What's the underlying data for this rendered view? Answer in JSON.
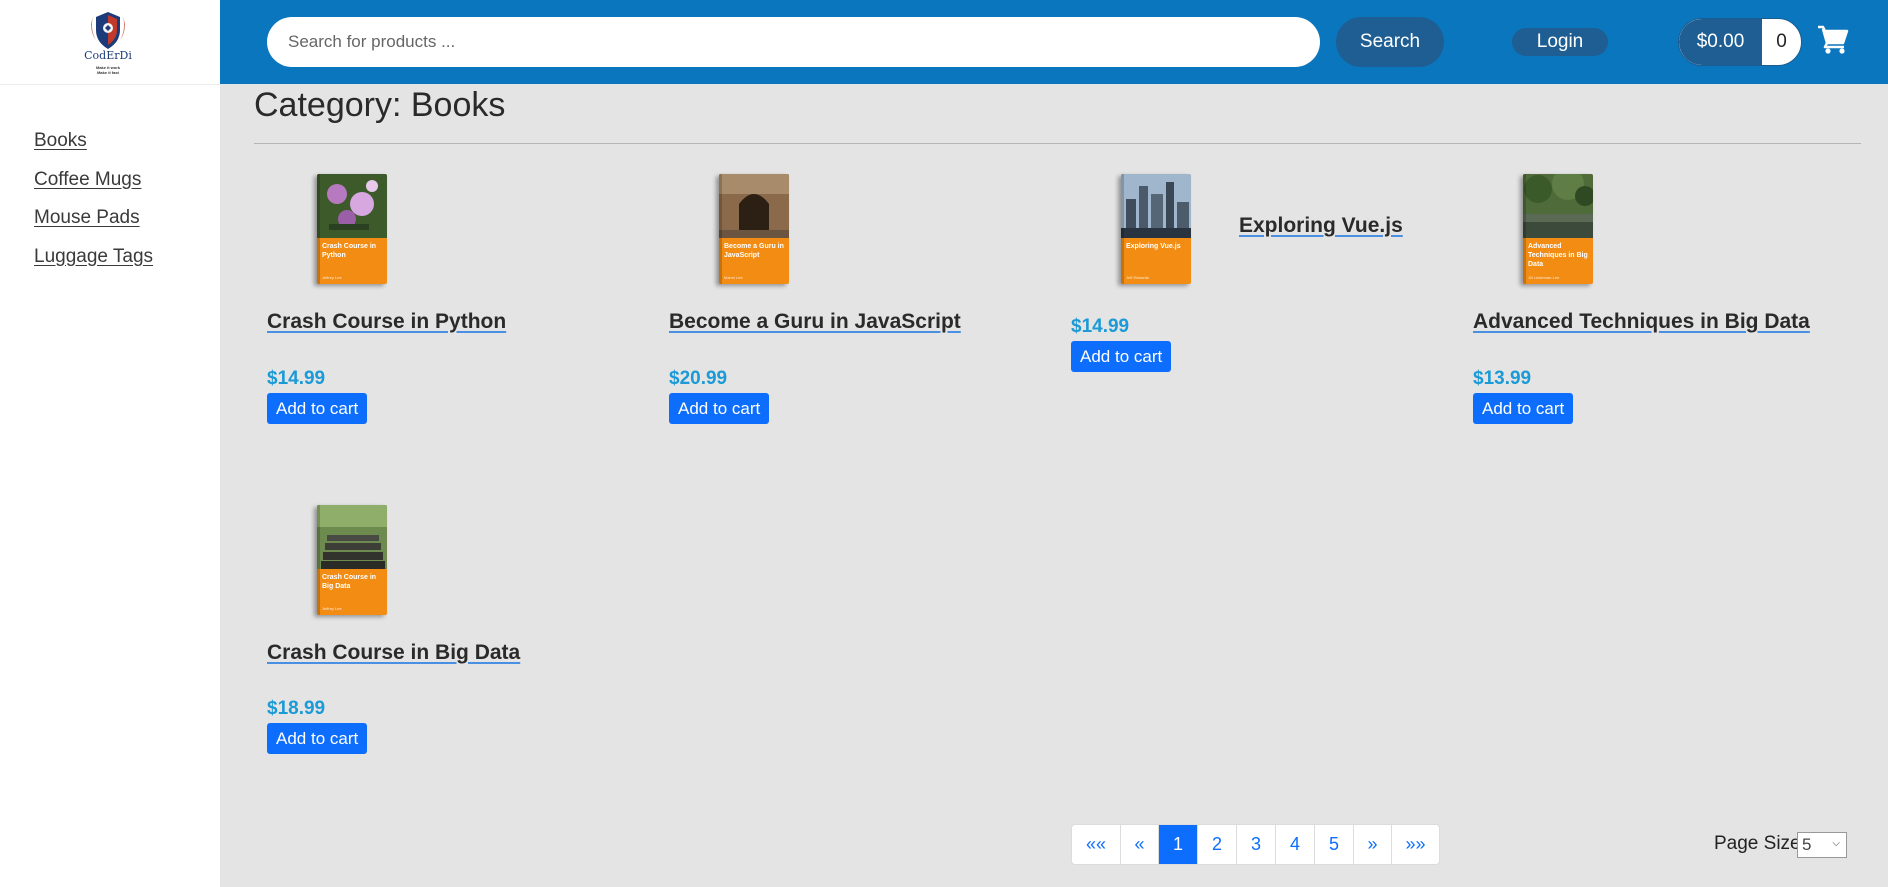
{
  "brand": {
    "name": "CodErDi",
    "tagline": "Make it work\nMake it fast"
  },
  "sidebar": {
    "items": [
      {
        "label": "Books"
      },
      {
        "label": "Coffee Mugs"
      },
      {
        "label": "Mouse Pads"
      },
      {
        "label": "Luggage Tags"
      }
    ]
  },
  "header": {
    "search_placeholder": "Search for products ...",
    "search_label": "Search",
    "login_label": "Login",
    "cart_total": "$0.00",
    "cart_count": "0",
    "cart_icon": "shopping-cart-icon"
  },
  "main": {
    "title": "Category: Books",
    "add_to_cart_label": "Add to cart",
    "products": [
      {
        "name": "Crash Course in Python",
        "price": "$14.99",
        "cover_title": "Crash Course in Python",
        "cover_author": "Jeffrey Lee"
      },
      {
        "name": "Become a Guru in JavaScript",
        "price": "$20.99",
        "cover_title": "Become a Guru in JavaScript",
        "cover_author": "Manni Lee"
      },
      {
        "name": "Exploring Vue.js",
        "price": "$14.99",
        "cover_title": "Exploring Vue.js",
        "cover_author": "Jeff Edwards"
      },
      {
        "name": "Advanced Techniques in Big Data",
        "price": "$13.99",
        "cover_title": "Advanced Techniques in Big Data",
        "cover_author": "Jill Lindeman-Lee"
      },
      {
        "name": "Crash Course in Big Data",
        "price": "$18.99",
        "cover_title": "Crash Course in Big Data",
        "cover_author": "Jeffrey Lee"
      }
    ]
  },
  "pagination": {
    "first": "««",
    "prev": "«",
    "pages": [
      "1",
      "2",
      "3",
      "4",
      "5"
    ],
    "current": "1",
    "next": "»",
    "last": "»»",
    "page_size_label": "Page Size",
    "page_size_value": "5"
  },
  "colors": {
    "header_bg": "#0a76bd",
    "button_dark": "#1e5e93",
    "primary": "#0d6efd",
    "price": "#1a9ad6",
    "book_orange": "#f28c12"
  }
}
